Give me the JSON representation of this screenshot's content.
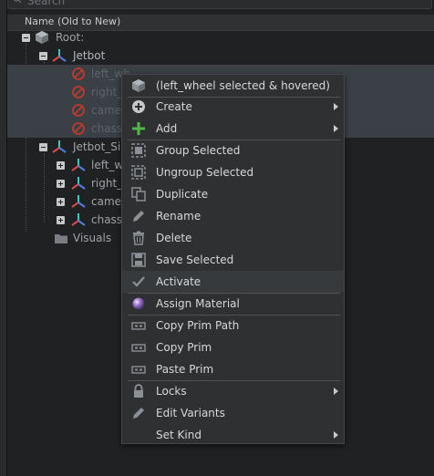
{
  "search": {
    "placeholder": "Search"
  },
  "header": {
    "column_title": "Name (Old to New)"
  },
  "tree": {
    "root": "Root:",
    "jetbot": "Jetbot",
    "jetbot_children": [
      "left_wh",
      "right_",
      "came",
      "chass"
    ],
    "jetbot_sim": "Jetbot_Si",
    "jetbot_sim_children": [
      "left_w",
      "right_",
      "came",
      "chass"
    ],
    "visuals": "Visuals"
  },
  "menu": {
    "title": "(left_wheel selected & hovered)",
    "items": [
      {
        "label": "Create",
        "icon": "plus-circle-icon",
        "submenu": true
      },
      {
        "label": "Add",
        "icon": "plus-icon",
        "submenu": true
      },
      {
        "label": "Group Selected",
        "icon": "group-icon"
      },
      {
        "label": "Ungroup Selected",
        "icon": "ungroup-icon"
      },
      {
        "label": "Duplicate",
        "icon": "duplicate-icon"
      },
      {
        "label": "Rename",
        "icon": "pencil-icon"
      },
      {
        "label": "Delete",
        "icon": "trash-icon"
      },
      {
        "label": "Save Selected",
        "icon": "save-icon"
      },
      {
        "label": "Activate",
        "icon": "check-icon"
      },
      {
        "label": "Assign Material",
        "icon": "material-sphere-icon"
      },
      {
        "label": "Copy Prim Path",
        "icon": "copy-path-icon"
      },
      {
        "label": "Copy Prim",
        "icon": "copy-prim-icon"
      },
      {
        "label": "Paste Prim",
        "icon": "paste-prim-icon"
      },
      {
        "label": "Locks",
        "icon": "lock-icon",
        "submenu": true
      },
      {
        "label": "Edit Variants",
        "icon": "pencil-icon"
      },
      {
        "label": "Set Kind",
        "icon": "",
        "submenu": true
      }
    ]
  },
  "colors": {
    "accent_green": "#4fb848",
    "xform_red": "#e04848",
    "xform_teal": "#3ec9c0",
    "xform_blue": "#4a7fe0",
    "disabled_red": "#c0392b"
  }
}
